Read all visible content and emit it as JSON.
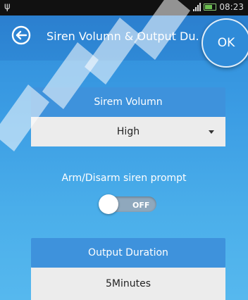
{
  "statusbar": {
    "time": "08:23"
  },
  "titlebar": {
    "title": "Siren Volumn & Output Du.",
    "ok_label": "OK"
  },
  "siren_volume": {
    "header": "Sirem Volumn",
    "value": "High"
  },
  "prompt": {
    "label": "Arm/Disarm siren prompt",
    "toggle_state": "OFF"
  },
  "output_duration": {
    "header": "Output Duration",
    "value": "5Minutes"
  },
  "colors": {
    "primary": "#2f8bd8",
    "panel_header": "#3e92dc",
    "panel_body": "#ececec"
  },
  "icons": {
    "back": "back-arrow-icon",
    "usb": "usb-icon",
    "signal": "signal-icon",
    "battery": "battery-icon"
  }
}
